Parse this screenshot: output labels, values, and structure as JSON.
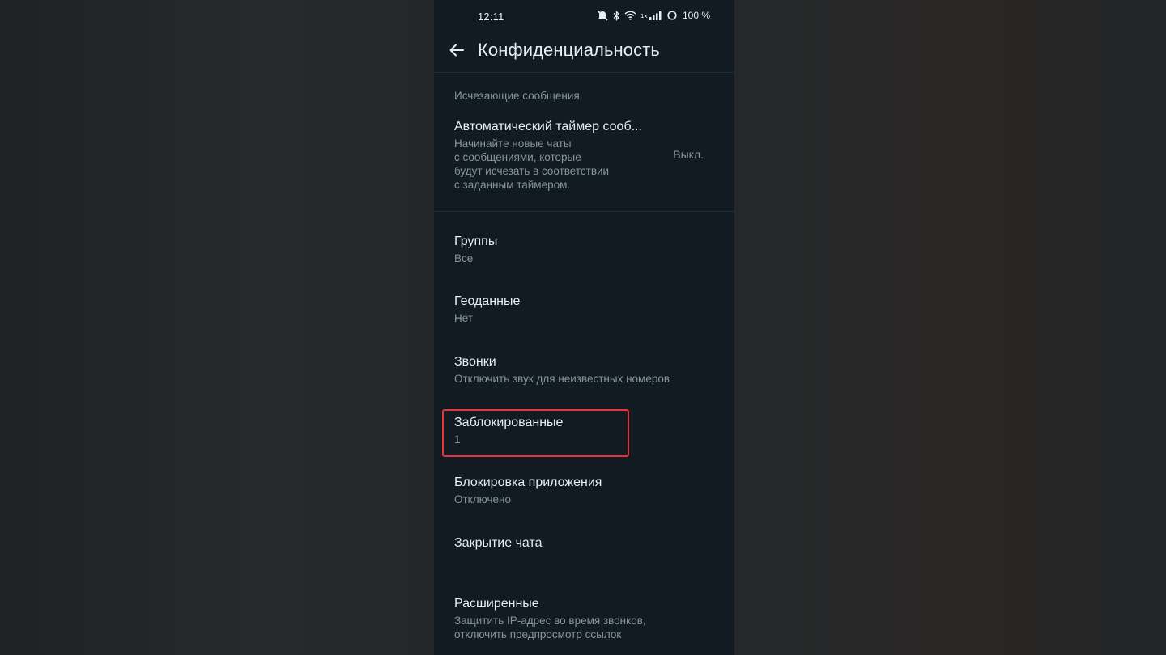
{
  "status": {
    "time": "12:11",
    "battery": "100 %"
  },
  "appbar": {
    "title": "Конфиденциальность"
  },
  "sections": {
    "disappearing_header": "Исчезающие сообщения"
  },
  "auto_timer": {
    "title": "Автоматический таймер сооб...",
    "desc": [
      "Начинайте новые чаты",
      "с сообщениями, которые",
      "будут исчезать в соответствии",
      "с заданным таймером."
    ],
    "value": "Выкл."
  },
  "items": [
    {
      "title": "Группы",
      "sub": [
        "Все"
      ]
    },
    {
      "title": "Геоданные",
      "sub": [
        "Нет"
      ]
    },
    {
      "title": "Звонки",
      "sub": [
        "Отключить звук для неизвестных номеров"
      ]
    },
    {
      "title": "Заблокированные",
      "sub": [
        "1"
      ]
    },
    {
      "title": "Блокировка приложения",
      "sub": [
        "Отключено"
      ]
    },
    {
      "title": "Закрытие чата",
      "sub": []
    },
    {
      "title": "Расширенные",
      "sub": [
        "Защитить IP-адрес во время звонков,",
        "отключить предпросмотр ссылок"
      ]
    }
  ],
  "colors": {
    "background": "#111b21",
    "primary_text": "#e9edef",
    "secondary_text": "#8696a0",
    "highlight": "#e0383a"
  },
  "icons": [
    "back-arrow-icon",
    "mute-icon",
    "bluetooth-icon",
    "wifi-icon",
    "signal-icon",
    "battery-icon"
  ]
}
